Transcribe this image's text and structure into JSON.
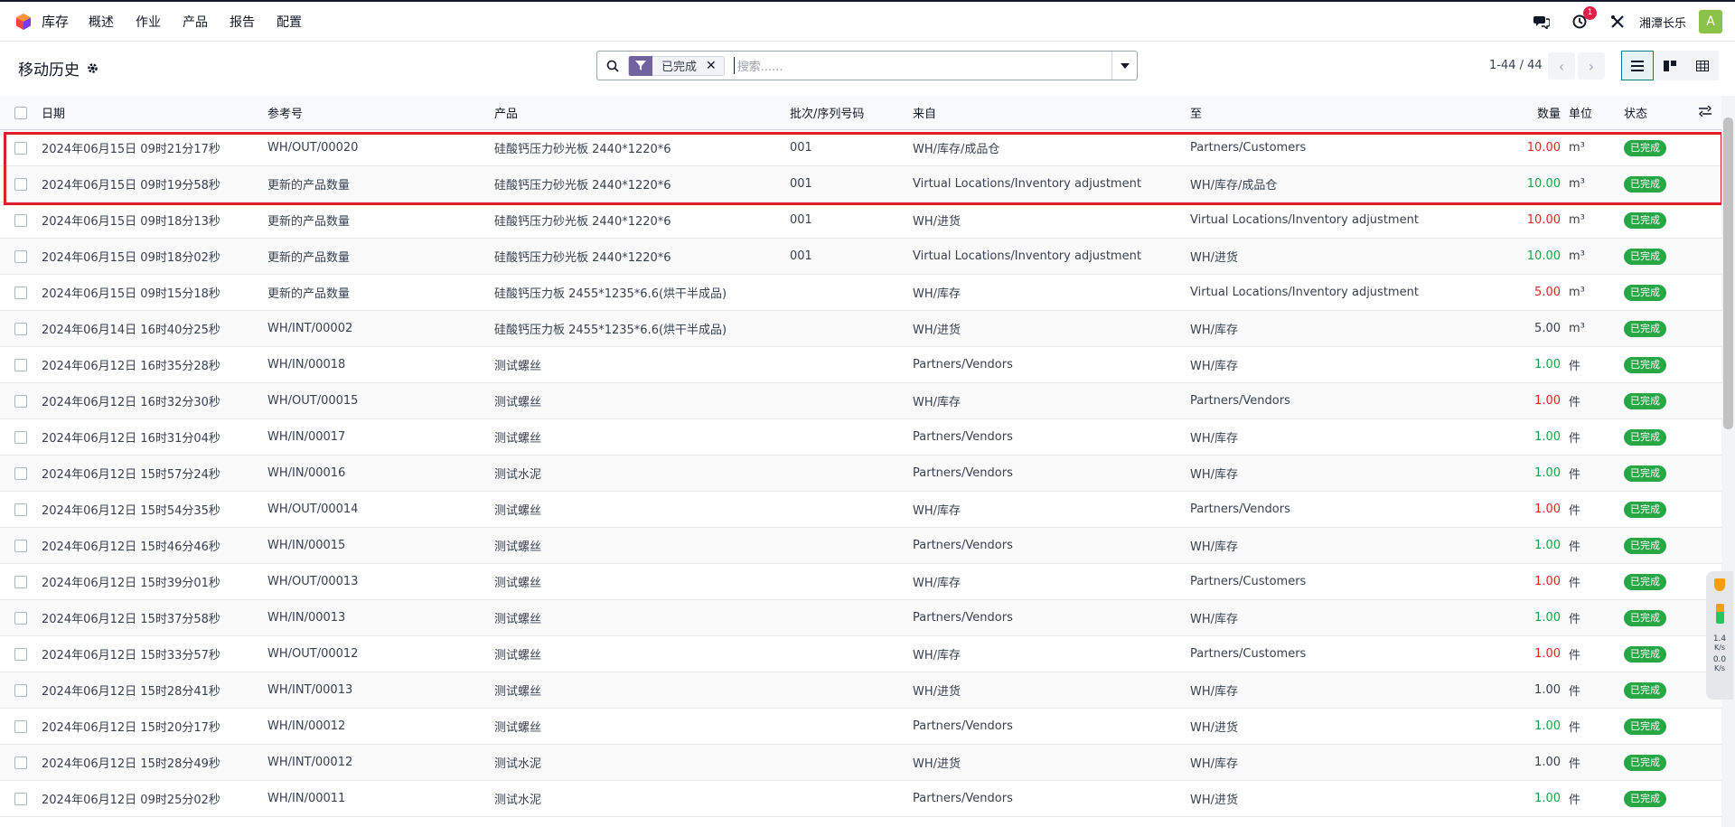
{
  "navbar": {
    "app_name": "库存",
    "menu": [
      "概述",
      "作业",
      "产品",
      "报告",
      "配置"
    ],
    "activity_badge": "1",
    "company": "湘潭长乐",
    "avatar_letter": "A"
  },
  "control": {
    "breadcrumb": "移动历史",
    "facet_label": "已完成",
    "search_placeholder": "搜索......",
    "pager": "1-44 / 44"
  },
  "columns": {
    "date": "日期",
    "reference": "参考号",
    "product": "产品",
    "lot": "批次/序列号码",
    "from": "来自",
    "to": "至",
    "qty": "数量",
    "uom": "单位",
    "state": "状态"
  },
  "rows": [
    {
      "date": "2024年06月15日 09时21分17秒",
      "ref": "WH/OUT/00020",
      "product": "硅酸钙压力砂光板 2440*1220*6",
      "lot": "001",
      "from": "WH/库存/成品仓",
      "to": "Partners/Customers",
      "qty": "10.00",
      "qty_color": "neg",
      "uom": "m³",
      "state": "已完成"
    },
    {
      "date": "2024年06月15日 09时19分58秒",
      "ref": "更新的产品数量",
      "product": "硅酸钙压力砂光板 2440*1220*6",
      "lot": "001",
      "from": "Virtual Locations/Inventory adjustment",
      "to": "WH/库存/成品仓",
      "qty": "10.00",
      "qty_color": "pos",
      "uom": "m³",
      "state": "已完成"
    },
    {
      "date": "2024年06月15日 09时18分13秒",
      "ref": "更新的产品数量",
      "product": "硅酸钙压力砂光板 2440*1220*6",
      "lot": "001",
      "from": "WH/进货",
      "to": "Virtual Locations/Inventory adjustment",
      "qty": "10.00",
      "qty_color": "neg",
      "uom": "m³",
      "state": "已完成"
    },
    {
      "date": "2024年06月15日 09时18分02秒",
      "ref": "更新的产品数量",
      "product": "硅酸钙压力砂光板 2440*1220*6",
      "lot": "001",
      "from": "Virtual Locations/Inventory adjustment",
      "to": "WH/进货",
      "qty": "10.00",
      "qty_color": "pos",
      "uom": "m³",
      "state": "已完成"
    },
    {
      "date": "2024年06月15日 09时15分18秒",
      "ref": "更新的产品数量",
      "product": "硅酸钙压力板 2455*1235*6.6(烘干半成品)",
      "lot": "",
      "from": "WH/库存",
      "to": "Virtual Locations/Inventory adjustment",
      "qty": "5.00",
      "qty_color": "neg",
      "uom": "m³",
      "state": "已完成"
    },
    {
      "date": "2024年06月14日 16时40分25秒",
      "ref": "WH/INT/00002",
      "product": "硅酸钙压力板 2455*1235*6.6(烘干半成品)",
      "lot": "",
      "from": "WH/进货",
      "to": "WH/库存",
      "qty": "5.00",
      "qty_color": "neu",
      "uom": "m³",
      "state": "已完成"
    },
    {
      "date": "2024年06月12日 16时35分28秒",
      "ref": "WH/IN/00018",
      "product": "测试螺丝",
      "lot": "",
      "from": "Partners/Vendors",
      "to": "WH/库存",
      "qty": "1.00",
      "qty_color": "pos",
      "uom": "件",
      "state": "已完成"
    },
    {
      "date": "2024年06月12日 16时32分30秒",
      "ref": "WH/OUT/00015",
      "product": "测试螺丝",
      "lot": "",
      "from": "WH/库存",
      "to": "Partners/Vendors",
      "qty": "1.00",
      "qty_color": "neg",
      "uom": "件",
      "state": "已完成"
    },
    {
      "date": "2024年06月12日 16时31分04秒",
      "ref": "WH/IN/00017",
      "product": "测试螺丝",
      "lot": "",
      "from": "Partners/Vendors",
      "to": "WH/库存",
      "qty": "1.00",
      "qty_color": "pos",
      "uom": "件",
      "state": "已完成"
    },
    {
      "date": "2024年06月12日 15时57分24秒",
      "ref": "WH/IN/00016",
      "product": "测试水泥",
      "lot": "",
      "from": "Partners/Vendors",
      "to": "WH/库存",
      "qty": "1.00",
      "qty_color": "pos",
      "uom": "件",
      "state": "已完成"
    },
    {
      "date": "2024年06月12日 15时54分35秒",
      "ref": "WH/OUT/00014",
      "product": "测试螺丝",
      "lot": "",
      "from": "WH/库存",
      "to": "Partners/Vendors",
      "qty": "1.00",
      "qty_color": "neg",
      "uom": "件",
      "state": "已完成"
    },
    {
      "date": "2024年06月12日 15时46分46秒",
      "ref": "WH/IN/00015",
      "product": "测试螺丝",
      "lot": "",
      "from": "Partners/Vendors",
      "to": "WH/库存",
      "qty": "1.00",
      "qty_color": "pos",
      "uom": "件",
      "state": "已完成"
    },
    {
      "date": "2024年06月12日 15时39分01秒",
      "ref": "WH/OUT/00013",
      "product": "测试螺丝",
      "lot": "",
      "from": "WH/库存",
      "to": "Partners/Customers",
      "qty": "1.00",
      "qty_color": "neg",
      "uom": "件",
      "state": "已完成"
    },
    {
      "date": "2024年06月12日 15时37分58秒",
      "ref": "WH/IN/00013",
      "product": "测试螺丝",
      "lot": "",
      "from": "Partners/Vendors",
      "to": "WH/库存",
      "qty": "1.00",
      "qty_color": "pos",
      "uom": "件",
      "state": "已完成"
    },
    {
      "date": "2024年06月12日 15时33分57秒",
      "ref": "WH/OUT/00012",
      "product": "测试螺丝",
      "lot": "",
      "from": "WH/库存",
      "to": "Partners/Customers",
      "qty": "1.00",
      "qty_color": "neg",
      "uom": "件",
      "state": "已完成"
    },
    {
      "date": "2024年06月12日 15时28分41秒",
      "ref": "WH/INT/00013",
      "product": "测试螺丝",
      "lot": "",
      "from": "WH/进货",
      "to": "WH/库存",
      "qty": "1.00",
      "qty_color": "neu",
      "uom": "件",
      "state": "已完成"
    },
    {
      "date": "2024年06月12日 15时20分17秒",
      "ref": "WH/IN/00012",
      "product": "测试螺丝",
      "lot": "",
      "from": "Partners/Vendors",
      "to": "WH/进货",
      "qty": "1.00",
      "qty_color": "pos",
      "uom": "件",
      "state": "已完成"
    },
    {
      "date": "2024年06月12日 15时28分49秒",
      "ref": "WH/INT/00012",
      "product": "测试水泥",
      "lot": "",
      "from": "WH/进货",
      "to": "WH/库存",
      "qty": "1.00",
      "qty_color": "neu",
      "uom": "件",
      "state": "已完成"
    },
    {
      "date": "2024年06月12日 09时25分02秒",
      "ref": "WH/IN/00011",
      "product": "测试水泥",
      "lot": "",
      "from": "Partners/Vendors",
      "to": "WH/进货",
      "qty": "1.00",
      "qty_color": "pos",
      "uom": "件",
      "state": "已完成"
    }
  ],
  "side_widget": {
    "up": "1.4",
    "up_unit": "K/s",
    "down": "0.0",
    "down_unit": "K/s"
  },
  "colors": {
    "brand": "#71639e",
    "accent": "#017e84",
    "done_badge": "#28a745",
    "negative": "#dc2626",
    "positive": "#16a34a",
    "highlight": "#e11d2e"
  }
}
